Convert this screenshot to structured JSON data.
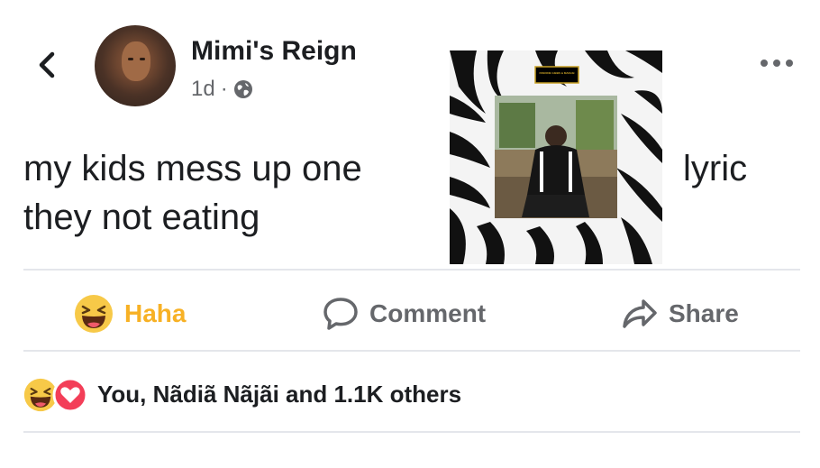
{
  "post": {
    "author": "Mimi's Reign",
    "time": "1d",
    "separator": "·",
    "text_line1": "my kids mess up one",
    "text_line2": "they not eating",
    "text_after_image": "lyric"
  },
  "album_art": {
    "banner_text": "FREDDIE GIBBS & MADLIB"
  },
  "actions": {
    "haha_label": "Haha",
    "comment_label": "Comment",
    "share_label": "Share"
  },
  "reactions": {
    "summary": "You, Nãdiã Nãjãi and 1.1K others"
  },
  "icons": {
    "back": "chevron-left-icon",
    "more": "more-icon",
    "audience": "globe-icon",
    "haha": "haha-emoji-icon",
    "comment": "comment-icon",
    "share": "share-icon",
    "love": "love-icon"
  },
  "colors": {
    "haha": "#f7b125",
    "love": "#f33e58",
    "secondary_text": "#65676b",
    "divider": "#e4e6eb"
  }
}
